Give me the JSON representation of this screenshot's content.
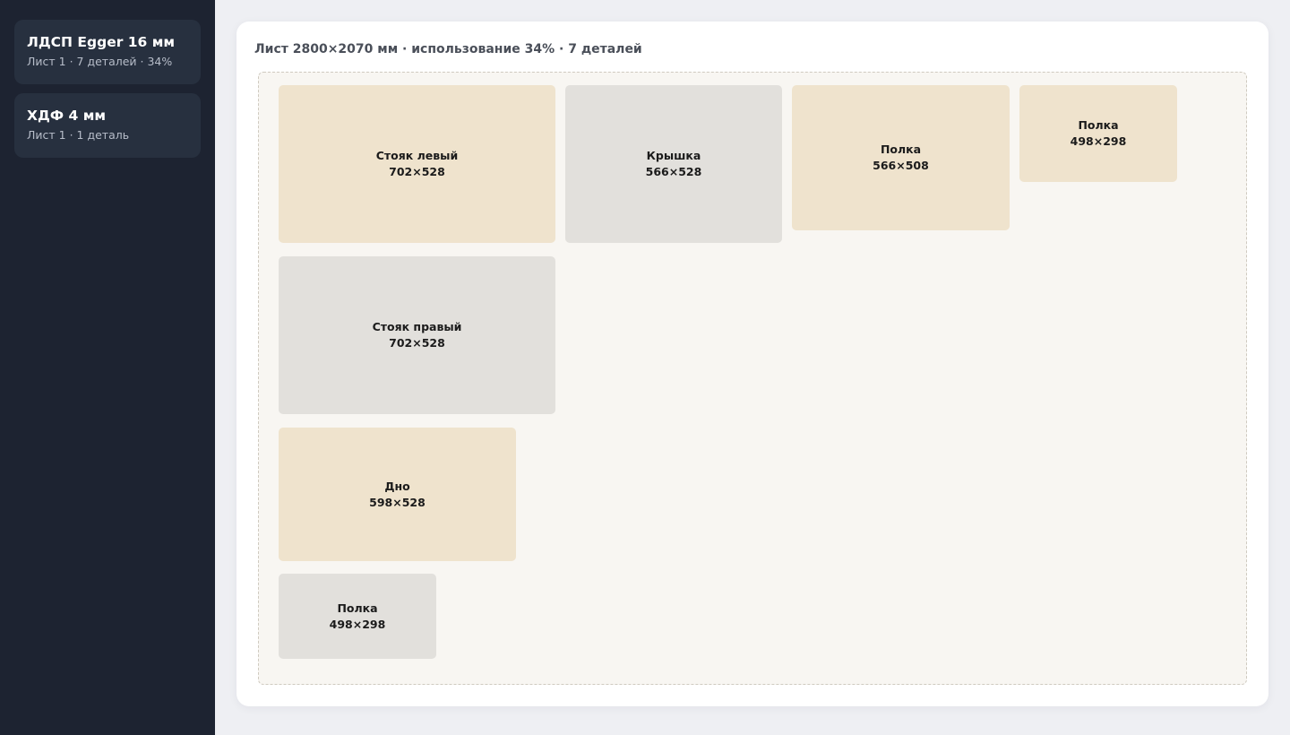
{
  "sidebar": {
    "sheets": [
      {
        "title": "ЛДСП Egger 16 мм",
        "subtitle": "Лист 1 · 7 деталей · 34%"
      },
      {
        "title": "ХДФ 4 мм",
        "subtitle": "Лист 1 · 1 деталь"
      }
    ]
  },
  "main": {
    "header": "Лист 2800×2070 мм · использование 34% · 7 деталей",
    "parts": [
      {
        "name": "Стояк левый",
        "size": "702×528"
      },
      {
        "name": "Крышка",
        "size": "566×528"
      },
      {
        "name": "Полка",
        "size": "566×508"
      },
      {
        "name": "Полка",
        "size": "498×298"
      },
      {
        "name": "Стояк правый",
        "size": "702×528"
      },
      {
        "name": "Дно",
        "size": "598×528"
      },
      {
        "name": "Полка",
        "size": "498×298"
      }
    ]
  },
  "colors": {
    "sidebar_bg": "#1d2331",
    "card_bg": "#27303f",
    "part_beige": "#efe3cd",
    "part_grey": "#e2e0dc",
    "sheet_bg": "#f8f6f2"
  }
}
